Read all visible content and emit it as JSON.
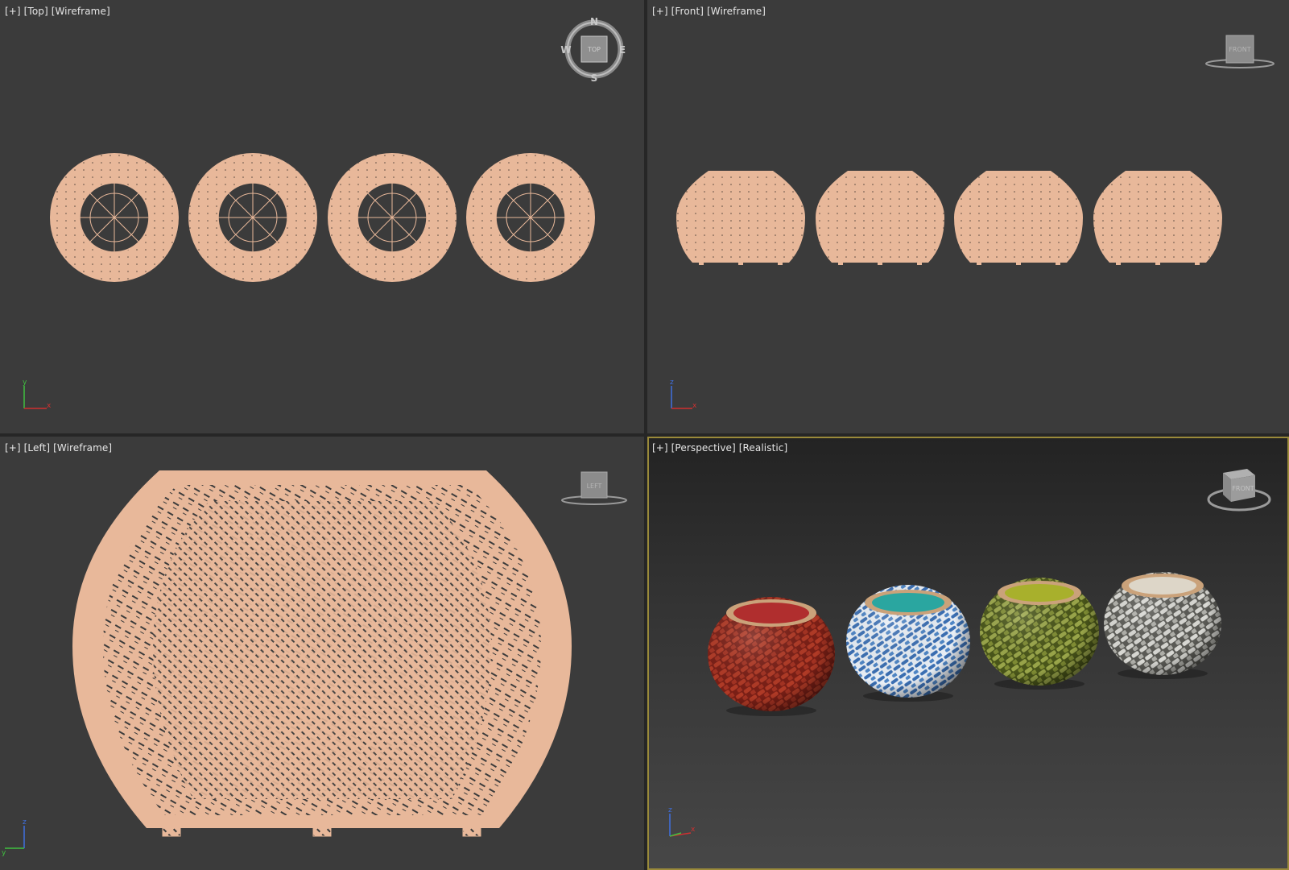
{
  "viewports": {
    "top": {
      "plus": "[+]",
      "view": "[Top]",
      "shading": "[Wireframe]",
      "compass": {
        "n": "N",
        "s": "S",
        "e": "E",
        "w": "W",
        "cube": "TOP"
      },
      "axes": {
        "a": "y",
        "b": "x"
      }
    },
    "front": {
      "plus": "[+]",
      "view": "[Front]",
      "shading": "[Wireframe]",
      "cube": "FRONT",
      "axes": {
        "a": "z",
        "b": "x"
      }
    },
    "left": {
      "plus": "[+]",
      "view": "[Left]",
      "shading": "[Wireframe]",
      "cube": "LEFT",
      "axes": {
        "a": "z",
        "b": "y"
      }
    },
    "perspective": {
      "plus": "[+]",
      "view": "[Perspective]",
      "shading": "[Realistic]",
      "cube": "FRONT",
      "axes": {
        "a": "z",
        "b": "x"
      }
    }
  },
  "colors": {
    "wire": "#e8b89a",
    "active_border": "#9a8a3a",
    "pouf_red": "#9a2a1e",
    "pouf_blue": "#3f74b8",
    "pouf_green": "#6b7a2a",
    "pouf_grey": "#8c8c86"
  }
}
